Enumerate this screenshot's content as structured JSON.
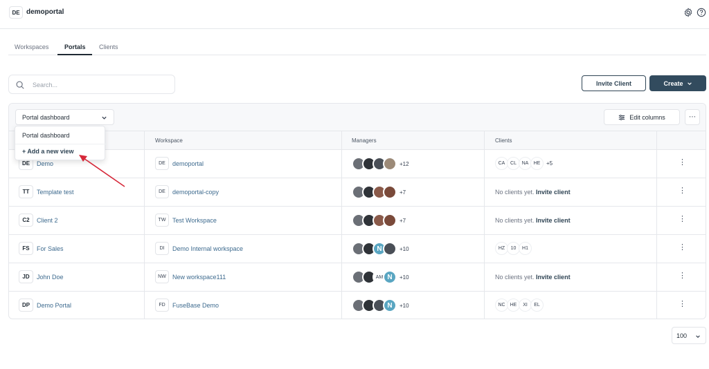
{
  "header": {
    "workspace_initials": "DE",
    "workspace_name": "demoportal"
  },
  "tabs": [
    {
      "label": "Workspaces",
      "active": false
    },
    {
      "label": "Portals",
      "active": true
    },
    {
      "label": "Clients",
      "active": false
    }
  ],
  "search": {
    "placeholder": "Search..."
  },
  "actions": {
    "invite_label": "Invite Client",
    "create_label": "Create"
  },
  "toolbar": {
    "view_selected": "Portal dashboard",
    "edit_columns_label": "Edit columns"
  },
  "view_dropdown": {
    "items": [
      "Portal dashboard"
    ],
    "add_label": "+ Add a new view"
  },
  "table": {
    "columns": [
      "Workspace",
      "Managers",
      "Clients"
    ],
    "rows": [
      {
        "initials": "DE",
        "name": "Demo",
        "ws_initials": "DE",
        "workspace": "demoportal",
        "manager_more": "+12",
        "clients": [
          "CA",
          "CL",
          "NA",
          "HE"
        ],
        "clients_more": "+5"
      },
      {
        "initials": "TT",
        "name": "Template test",
        "ws_initials": "DE",
        "workspace": "demoportal-copy",
        "manager_more": "+7",
        "no_clients": "No clients yet.",
        "invite_link": "Invite client"
      },
      {
        "initials": "C2",
        "name": "Client 2",
        "ws_initials": "TW",
        "workspace": "Test Workspace",
        "manager_more": "+7",
        "no_clients": "No clients yet.",
        "invite_link": "Invite client"
      },
      {
        "initials": "FS",
        "name": "For Sales",
        "ws_initials": "DI",
        "workspace": "Demo Internal workspace",
        "manager_more": "+10",
        "clients": [
          "HZ",
          "10",
          "H1"
        ]
      },
      {
        "initials": "JD",
        "name": "John Doe",
        "ws_initials": "NW",
        "workspace": "New workspace111",
        "manager_text_avatar": "AM",
        "manager_more": "+10",
        "no_clients": "No clients yet.",
        "invite_link": "Invite client"
      },
      {
        "initials": "DP",
        "name": "Demo Portal",
        "ws_initials": "FD",
        "workspace": "FuseBase Demo",
        "manager_more": "+10",
        "clients": [
          "NC",
          "HE",
          "XI",
          "EL"
        ]
      }
    ]
  },
  "pagination": {
    "page_size": "100"
  },
  "colors": {
    "primary": "#324b5e",
    "link": "#3d6a8e",
    "annotation_arrow": "#d62839"
  },
  "icons": [
    "settings-icon",
    "help-icon",
    "search-icon",
    "chevron-down-icon",
    "columns-icon",
    "more-icon",
    "kebab-icon"
  ]
}
